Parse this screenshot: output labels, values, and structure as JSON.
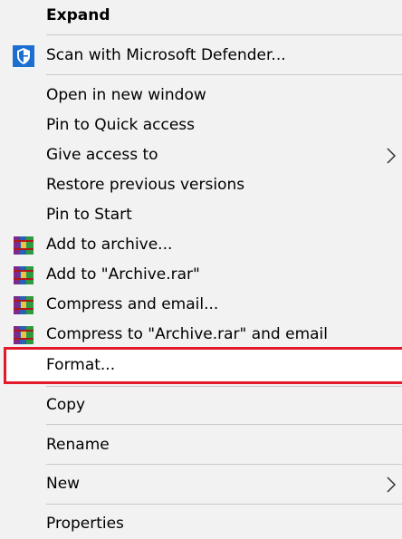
{
  "menu": {
    "expand": "Expand",
    "scan": "Scan with Microsoft Defender...",
    "open_new_window": "Open in new window",
    "pin_quick_access": "Pin to Quick access",
    "give_access": "Give access to",
    "restore_previous": "Restore previous versions",
    "pin_start": "Pin to Start",
    "add_archive": "Add to archive...",
    "add_archive_rar": "Add to \"Archive.rar\"",
    "compress_email": "Compress and email...",
    "compress_archive_email": "Compress to \"Archive.rar\" and email",
    "format": "Format...",
    "copy": "Copy",
    "rename": "Rename",
    "new": "New",
    "properties": "Properties"
  },
  "icons": {
    "defender": "defender-shield-icon",
    "winrar": "winrar-books-icon",
    "submenu": "chevron-right-icon"
  },
  "colors": {
    "menu_background": "#f2f2f2",
    "highlight_border": "#e21a2a",
    "defender_blue": "#1a6fd1"
  }
}
